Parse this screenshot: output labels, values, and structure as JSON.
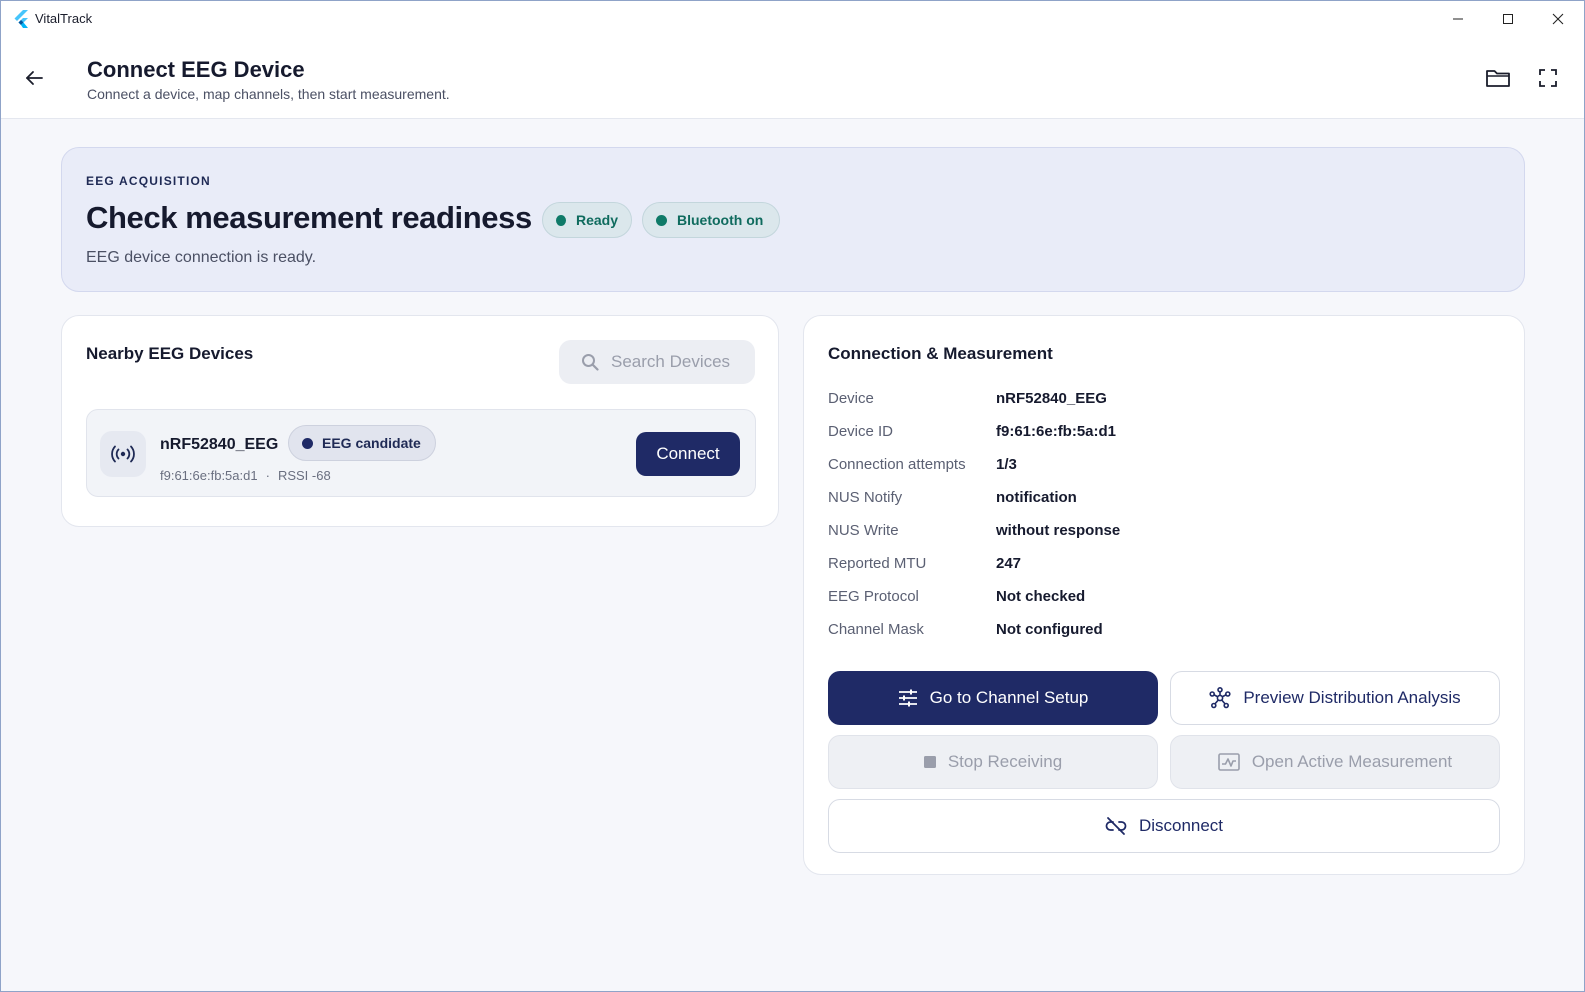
{
  "window": {
    "app_title": "VitalTrack"
  },
  "header": {
    "title": "Connect EEG Device",
    "subtitle": "Connect a device, map channels, then start measurement."
  },
  "banner": {
    "eyebrow": "EEG ACQUISITION",
    "title": "Check measurement readiness",
    "chips": [
      {
        "label": "Ready",
        "color": "#0f7a68"
      },
      {
        "label": "Bluetooth on",
        "color": "#0f7a68"
      }
    ],
    "description": "EEG device connection is ready."
  },
  "devices": {
    "title": "Nearby EEG Devices",
    "search_label": "Search Devices",
    "items": [
      {
        "name": "nRF52840_EEG",
        "badge": "EEG candidate",
        "address": "f9:61:6e:fb:5a:d1",
        "separator": "·",
        "rssi": "RSSI -68",
        "connect_label": "Connect"
      }
    ]
  },
  "connection": {
    "title": "Connection & Measurement",
    "details": [
      {
        "key": "Device",
        "value": "nRF52840_EEG"
      },
      {
        "key": "Device ID",
        "value": "f9:61:6e:fb:5a:d1"
      },
      {
        "key": "Connection attempts",
        "value": "1/3"
      },
      {
        "key": "NUS Notify",
        "value": "notification"
      },
      {
        "key": "NUS Write",
        "value": "without response"
      },
      {
        "key": "Reported MTU",
        "value": "247"
      },
      {
        "key": "EEG Protocol",
        "value": "Not checked"
      },
      {
        "key": "Channel Mask",
        "value": "Not configured"
      }
    ],
    "actions": {
      "channel_setup": "Go to Channel Setup",
      "preview_distribution": "Preview Distribution Analysis",
      "stop_receiving": "Stop Receiving",
      "open_active": "Open Active Measurement",
      "disconnect": "Disconnect"
    }
  },
  "theme": {
    "primary": "#1f2a66",
    "success": "#0f7a68",
    "background": "#f6f7fb"
  }
}
